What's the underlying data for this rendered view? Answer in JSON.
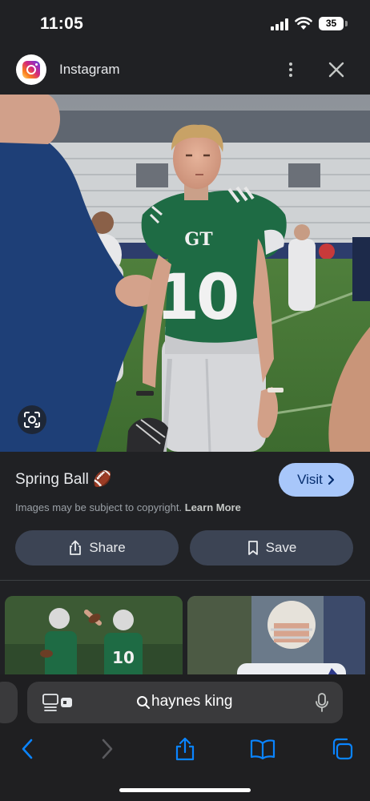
{
  "status_bar": {
    "time": "11:05",
    "battery_level": "35"
  },
  "source": {
    "name": "Instagram",
    "icon": "instagram-icon"
  },
  "result": {
    "title": "Spring Ball 🏈",
    "visit_label": "Visit",
    "copyright_text": "Images may be subject to copyright.",
    "learn_more_label": "Learn More",
    "share_label": "Share",
    "save_label": "Save"
  },
  "main_image": {
    "jersey_letters": "GT",
    "jersey_number": "10"
  },
  "related": {
    "thumb1_jersey_number": "10"
  },
  "browser": {
    "search_query": "haynes king",
    "icons": [
      "reader-icon",
      "search-icon",
      "mic-icon",
      "back-icon",
      "forward-icon",
      "share-icon",
      "bookmarks-icon",
      "tabs-icon"
    ]
  },
  "colors": {
    "accent": "#a8c7fa",
    "chip_background": "#3c4454",
    "safari_blue": "#0a84ff"
  }
}
